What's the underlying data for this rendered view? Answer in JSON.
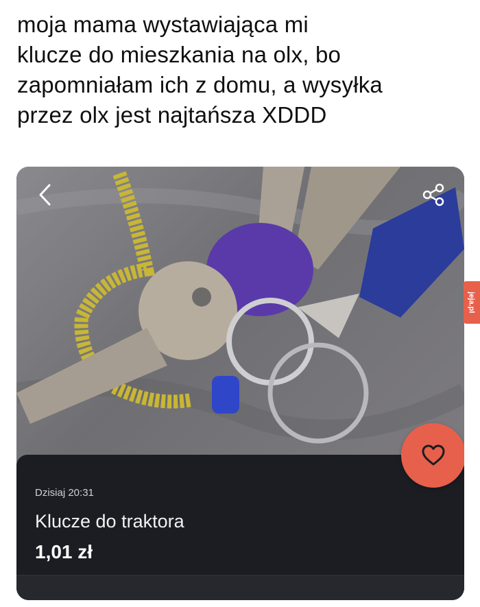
{
  "post": {
    "caption": "moja mama wystawiająca mi\nklucze do mieszkania na olx, bo\nzapomniałam ich z domu, a wysyłka\nprzez olx jest najtańsza XDDD"
  },
  "listing": {
    "date": "Dzisiaj 20:31",
    "title": "Klucze do traktora",
    "price": "1,01 zł",
    "photo_icon": "keys-photo",
    "back_icon": "chevron-left-icon",
    "share_icon": "share-icon",
    "favorite_icon": "heart-icon",
    "colors": {
      "card_background": "#1b1d22",
      "favorite_button": "#e7604b",
      "text_primary": "#ffffff"
    }
  },
  "watermark": {
    "text": "jeja.pl"
  }
}
